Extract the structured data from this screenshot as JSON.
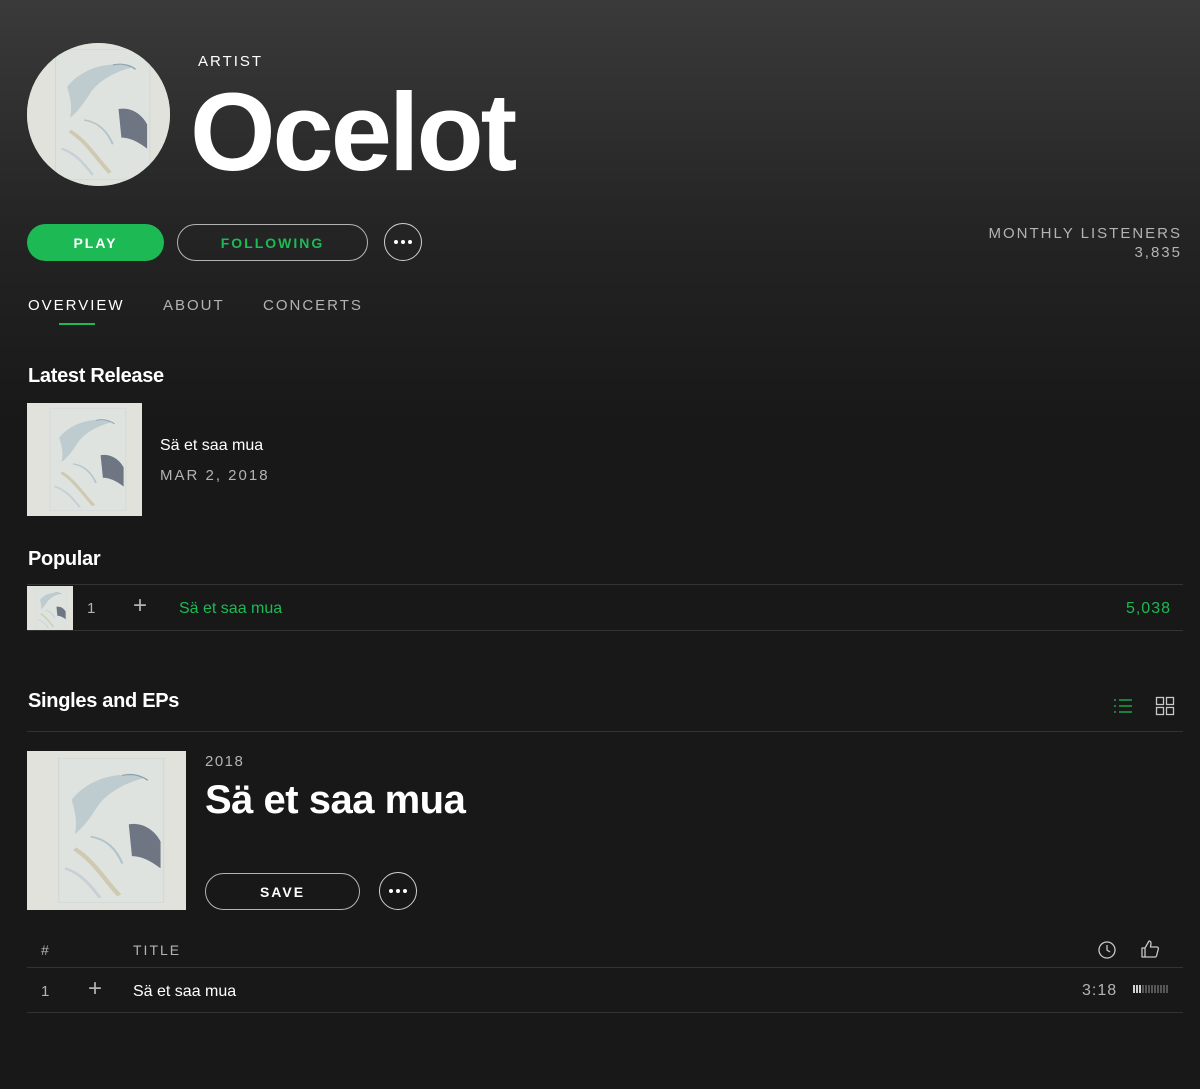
{
  "header": {
    "kicker": "ARTIST",
    "artist_name": "Ocelot",
    "avatar_icon": "artist-avatar-image"
  },
  "actions": {
    "play_label": "PLAY",
    "following_label": "FOLLOWING",
    "more_icon": "ellipsis-icon"
  },
  "stats": {
    "monthly_listeners_label": "MONTHLY LISTENERS",
    "monthly_listeners_value": "3,835"
  },
  "tabs": [
    {
      "label": "OVERVIEW",
      "active": true
    },
    {
      "label": "ABOUT",
      "active": false
    },
    {
      "label": "CONCERTS",
      "active": false
    }
  ],
  "latest_release": {
    "section_title": "Latest Release",
    "name": "Sä et saa mua",
    "date": "MAR 2, 2018"
  },
  "popular": {
    "section_title": "Popular",
    "tracks": [
      {
        "number": "1",
        "title": "Sä et saa mua",
        "plays": "5,038"
      }
    ]
  },
  "singles": {
    "section_title": "Singles and EPs",
    "view_icons": [
      "list-view-icon",
      "grid-view-icon"
    ],
    "album": {
      "year": "2018",
      "title": "Sä et saa mua",
      "save_label": "SAVE"
    },
    "table_header": {
      "number": "#",
      "title": "TITLE",
      "duration_icon": "clock-icon",
      "popularity_icon": "thumbs-up-icon"
    },
    "tracks": [
      {
        "number": "1",
        "title": "Sä et saa mua",
        "duration": "3:18",
        "popularity": 0.25
      }
    ]
  },
  "colors": {
    "accent": "#1db954",
    "background": "#181818",
    "muted_text": "#b3b3b3"
  }
}
